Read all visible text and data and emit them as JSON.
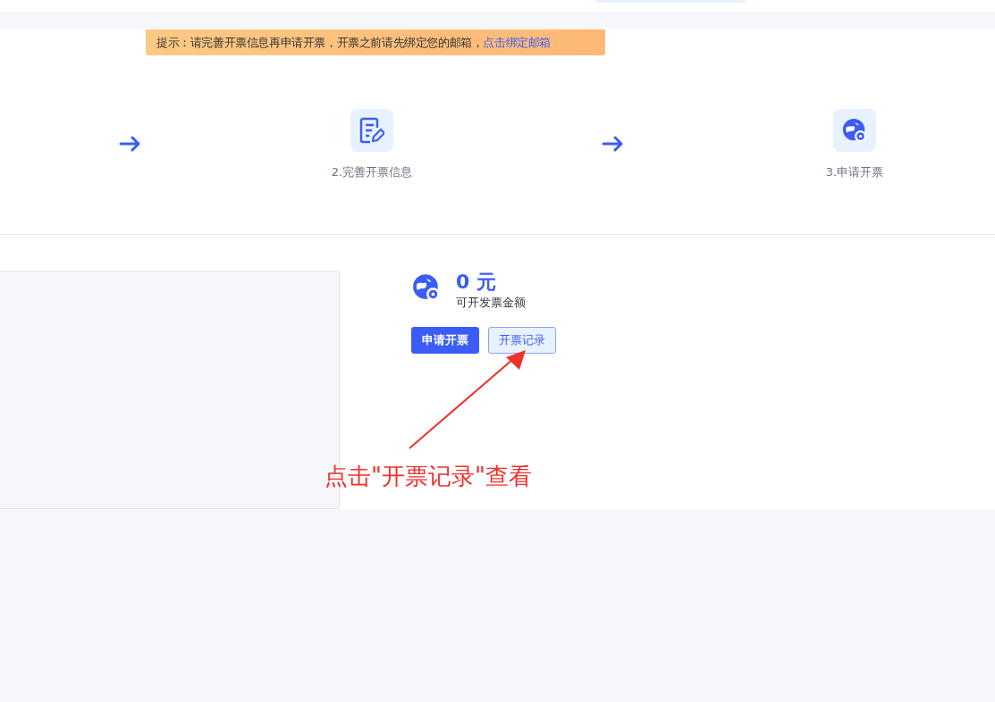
{
  "notice": {
    "text": "提示：请完善开票信息再申请开票，开票之前请先绑定您的邮箱，",
    "link": "点击绑定邮箱"
  },
  "steps": [
    {
      "kind": "arrow"
    },
    {
      "kind": "edit",
      "label": "2.完善开票信息"
    },
    {
      "kind": "arrow"
    },
    {
      "kind": "apply",
      "label": "3.申请开票"
    }
  ],
  "amount": {
    "value": "0 元",
    "label": "可开发票金额"
  },
  "buttons": [
    {
      "label": "申请开票",
      "kind": "primary"
    },
    {
      "label": "开票记录",
      "kind": "secondary"
    }
  ],
  "annotation": "点击\"开票记录\"查看"
}
